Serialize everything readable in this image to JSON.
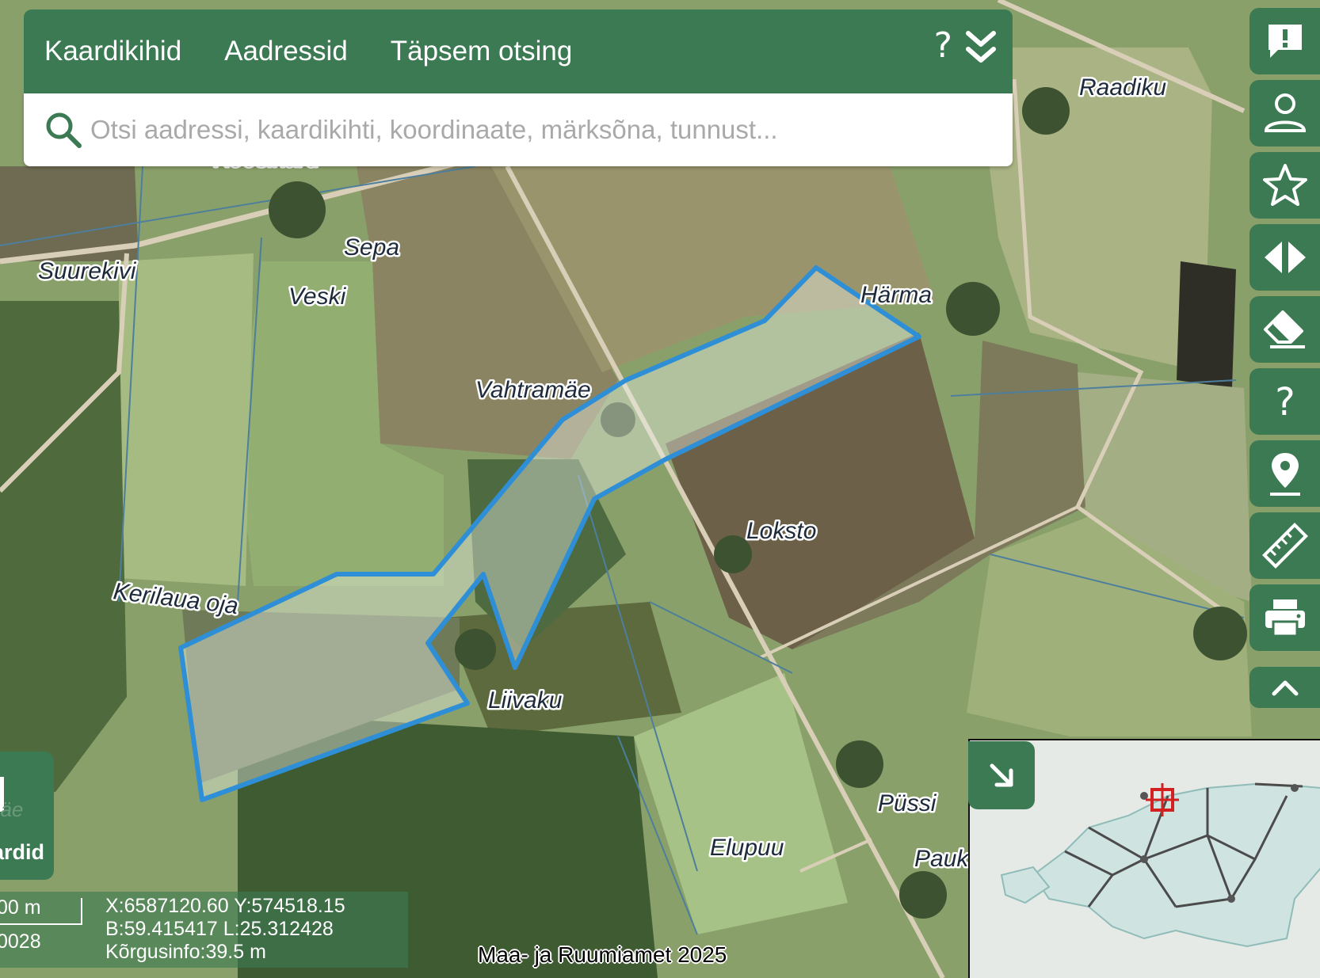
{
  "nav": {
    "tabs": [
      {
        "label": "Kaardikihid"
      },
      {
        "label": "Aadressid"
      },
      {
        "label": "Täpsem otsing"
      }
    ],
    "help": "?",
    "collapse_icon": "double-chevron-down-icon"
  },
  "search": {
    "placeholder": "Otsi aadressi, kaardikihti, koordinaate, märksõna, tunnust..."
  },
  "map_labels": {
    "raadiku": "Raadiku",
    "sepa": "Sepa",
    "suurekivi": "Suurekivi",
    "veski": "Veski",
    "harma": "Härma",
    "vahtramae": "Vahtramäe",
    "loksto": "Loksto",
    "kerilaua_oja": "Kerilaua oja",
    "liivaku": "Liivaku",
    "pussi": "Püssi",
    "elupuu": "Elupuu",
    "paukse": "Paukse",
    "partial_top": "Koosikaru"
  },
  "toolbar": {
    "buttons": [
      {
        "icon": "feedback-icon"
      },
      {
        "icon": "user-icon"
      },
      {
        "icon": "star-icon"
      },
      {
        "icon": "compare-icon"
      },
      {
        "icon": "eraser-icon"
      },
      {
        "icon": "help-icon"
      },
      {
        "icon": "location-pin-icon"
      },
      {
        "icon": "ruler-icon"
      },
      {
        "icon": "print-icon"
      },
      {
        "icon": "chevron-up-icon"
      }
    ]
  },
  "left_panel": {
    "label_partial": "näe",
    "label": "ardid"
  },
  "info": {
    "scale_text": "00 m",
    "scale_number": "0028",
    "coord_xy": "X:6587120.60 Y:574518.15",
    "coord_bl": "B:59.415417 L:25.312428",
    "elevation": "Kõrgusinfo:39.5 m"
  },
  "attribution": "Maa- ja Ruumiamet 2025",
  "overview": {
    "toggle_icon": "arrow-down-right-icon"
  },
  "colors": {
    "brand_green": "#3c7a53",
    "parcel_outline": "#2f8fd6",
    "marker_red": "#d32020"
  }
}
